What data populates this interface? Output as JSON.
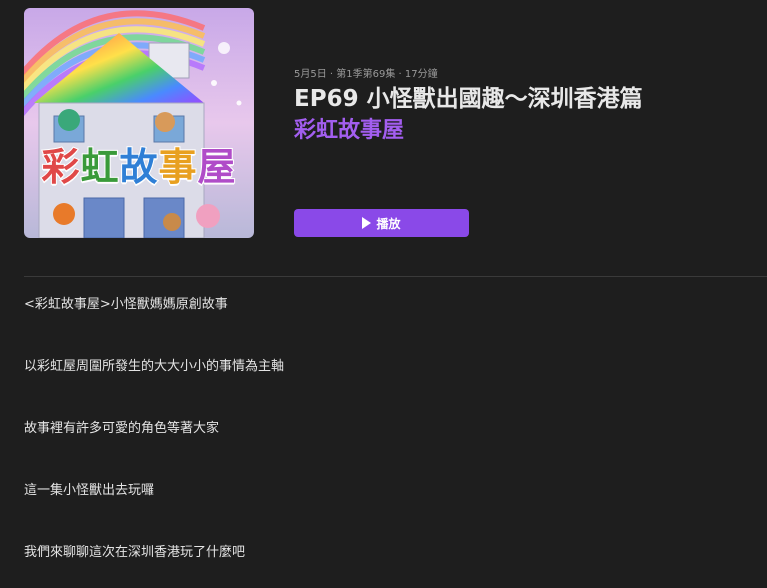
{
  "episode": {
    "meta": "5月5日 · 第1季第69集 · 17分鐘",
    "title": "EP69 小怪獸出國趣～深圳香港篇",
    "show_name": "彩虹故事屋"
  },
  "artwork": {
    "title_chars": [
      "彩",
      "虹",
      "故",
      "事",
      "屋"
    ],
    "title_colors": [
      "#e04848",
      "#3a9a3a",
      "#2f7fd6",
      "#e8a020",
      "#b04cc8"
    ]
  },
  "actions": {
    "play_label": "播放",
    "play_icon": "play-icon"
  },
  "description": {
    "lines": [
      "<彩虹故事屋>小怪獸媽媽原創故事",
      "以彩虹屋周圍所發生的大大小小的事情為主軸",
      "故事裡有許多可愛的角色等著大家",
      "這一集小怪獸出去玩囉",
      "我們來聊聊這次在深圳香港玩了什麼吧"
    ]
  },
  "colors": {
    "background": "#1e1e1e",
    "accent": "#8a49e8",
    "show_name": "#a35ef0"
  }
}
